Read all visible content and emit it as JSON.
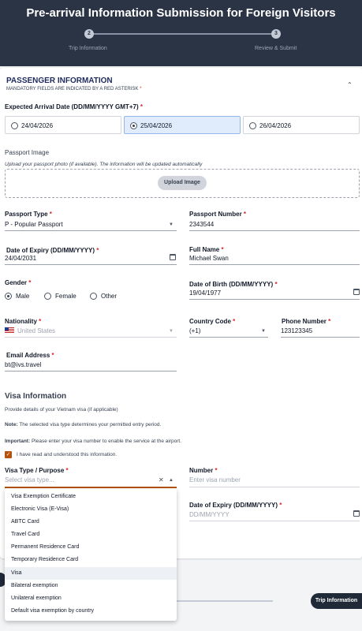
{
  "header": {
    "title": "Pre-arrival Information Submission for Foreign Visitors",
    "steps": [
      {
        "number": "2",
        "label": "Trip Information"
      },
      {
        "number": "3",
        "label": "Review & Submit"
      }
    ]
  },
  "passenger": {
    "title": "PASSENGER INFORMATION",
    "mandatory_note": "MANDATORY FIELDS ARE INDICATED BY A RED ASTERISK",
    "asterisk": "*"
  },
  "arrival": {
    "label": "Expected Arrival Date (DD/MM/YYYY GMT+7)",
    "options": [
      "24/04/2026",
      "25/04/2026",
      "26/04/2026"
    ],
    "selected": "25/04/2026"
  },
  "passport_image": {
    "label": "Passport Image",
    "hint": "Upload your passport photo (if available). The information will be updated automatically",
    "button": "Upload Image"
  },
  "passport_type": {
    "label": "Passport Type",
    "value": "P - Popular Passport"
  },
  "passport_number": {
    "label": "Passport Number",
    "value": "2343544"
  },
  "expiry": {
    "label": "Date of Expiry (DD/MM/YYYY)",
    "value": "24/04/2031"
  },
  "full_name": {
    "label": "Full Name",
    "value": "Michael Swan"
  },
  "gender": {
    "label": "Gender",
    "options": [
      "Male",
      "Female",
      "Other"
    ],
    "selected": "Male"
  },
  "dob": {
    "label": "Date of Birth (DD/MM/YYYY)",
    "value": "19/04/1977"
  },
  "nationality": {
    "label": "Nationality",
    "value": "United States"
  },
  "country_code": {
    "label": "Country Code",
    "value": "(+1)"
  },
  "phone": {
    "label": "Phone Number",
    "value": "123123345"
  },
  "email": {
    "label": "Email Address",
    "value": "bt@ivs.travel"
  },
  "visa": {
    "title": "Visa Information",
    "subtitle": "Provide details of your Vietnam visa (if applicable)",
    "note_label": "Note:",
    "note_text": "The selected visa type determines your permitted entry period.",
    "important_label": "Important:",
    "important_text": "Please enter your visa number to enable the service at the airport.",
    "ack": "I have read and understood this information.",
    "type_label": "Visa Type / Purpose",
    "type_placeholder": "Select visa type...",
    "number_label": "Number",
    "number_placeholder": "Enter visa number",
    "expiry_label": "Date of Expiry (DD/MM/YYYY)",
    "expiry_placeholder": "DD/MM/YYYY",
    "options": [
      "Visa Exemption Certificate",
      "Electronic Visa (E-Visa)",
      "ABTC Card",
      "Travel Card",
      "Permanent Residence Card",
      "Temporary Residence Card",
      "Visa",
      "Bilateral exemption",
      "Unilateral exemption",
      "Default visa exemption by country"
    ],
    "highlighted": "Visa"
  },
  "footer": {
    "button": "Trip Information"
  },
  "icons": {
    "clear": "✕",
    "caret_up": "▲",
    "caret_down": "▼",
    "chevron_up": "⌃",
    "check": "✓"
  }
}
